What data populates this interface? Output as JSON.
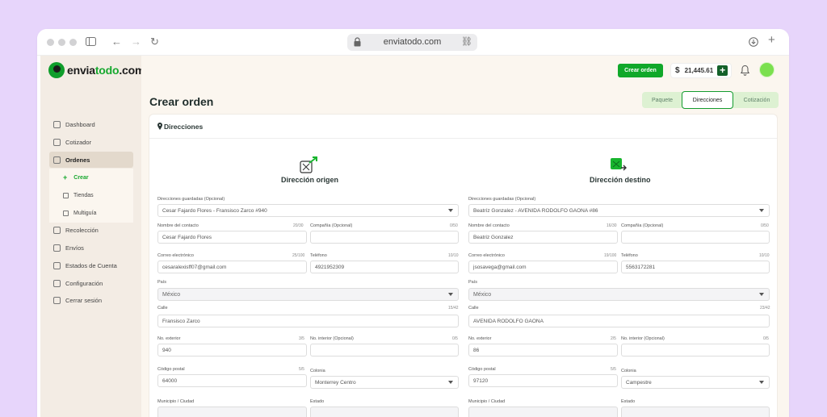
{
  "browser": {
    "url": "enviatodo.com"
  },
  "brand": {
    "name_prefix": "envia",
    "name_accent": "todo",
    "name_suffix": ".com",
    "accent_color": "#17a82f"
  },
  "sidebar": {
    "items": [
      {
        "label": "Dashboard",
        "icon": "home-icon"
      },
      {
        "label": "Cotizador",
        "icon": "calculator-icon"
      },
      {
        "label": "Ordenes",
        "icon": "orders-icon"
      },
      {
        "label": "Recolección",
        "icon": "truck-icon"
      },
      {
        "label": "Envíos",
        "icon": "send-icon"
      },
      {
        "label": "Estados de Cuenta",
        "icon": "statement-icon"
      },
      {
        "label": "Configuración",
        "icon": "gear-icon"
      },
      {
        "label": "Cerrar sesión",
        "icon": "logout-icon"
      }
    ],
    "submenu": [
      {
        "label": "Crear",
        "icon": "plus-icon"
      },
      {
        "label": "Tiendas",
        "icon": "store-icon"
      },
      {
        "label": "Multiguía",
        "icon": "multiguide-icon"
      }
    ]
  },
  "topbar": {
    "create_order_label": "Crear orden",
    "balance_symbol": "$",
    "balance": "21,445.61",
    "add_symbol": "+"
  },
  "page": {
    "title": "Crear orden",
    "steps": [
      "Paquete",
      "Direcciones",
      "Cotización"
    ],
    "active_step": "Direcciones"
  },
  "card": {
    "title": "Direcciones"
  },
  "origin": {
    "title": "Dirección origen",
    "saved_label": "Direcciones guardadas (Opcional)",
    "saved_value": "Cesar Fajardo Flores - Fransisco Zarco #940",
    "contact_label": "Nombre del contacto",
    "contact_count": "20/30",
    "contact_value": "Cesar Fajardo Flores",
    "company_label": "Compañía (Opcional)",
    "company_count": "0/50",
    "email_label": "Correo electrónico",
    "email_count": "25/100",
    "email_value": "cesaralexisff07@gmail.com",
    "phone_label": "Teléfono",
    "phone_count": "10/10",
    "phone_value": "4921952309",
    "country_label": "País",
    "country_value": "México",
    "street_label": "Calle",
    "street_count": "15/42",
    "street_value": "Fransisco Zarco",
    "ext_label": "No. exterior",
    "ext_count": "3/5",
    "ext_value": "940",
    "int_label": "No. interior (Opcional)",
    "int_count": "0/5",
    "zip_label": "Código postal",
    "zip_count": "5/5",
    "zip_value": "64000",
    "colonia_label": "Colonia",
    "colonia_value": "Monterrey Centro",
    "city_label": "Municipio / Ciudad",
    "state_label": "Estado"
  },
  "destination": {
    "title": "Dirección destino",
    "saved_label": "Direcciones guardadas (Opcional)",
    "saved_value": "Beatríz Gonzalez - AVENIDA RODOLFO GAONA #86",
    "contact_label": "Nombre del contacto",
    "contact_count": "16/30",
    "contact_value": "Beatriz Gonzalez",
    "company_label": "Compañía (Opcional)",
    "company_count": "0/50",
    "email_label": "Correo electrónico",
    "email_count": "19/100",
    "email_value": "jsosavega@gmail.com",
    "phone_label": "Teléfono",
    "phone_count": "10/10",
    "phone_value": "5563172281",
    "country_label": "País",
    "country_value": "México",
    "street_label": "Calle",
    "street_count": "23/42",
    "street_value": "AVENIDA RODOLFO GAONA",
    "ext_label": "No. exterior",
    "ext_count": "2/5",
    "ext_value": "86",
    "int_label": "No. interior (Opcional)",
    "int_count": "0/5",
    "zip_label": "Código postal",
    "zip_count": "5/5",
    "zip_value": "97120",
    "colonia_label": "Colonia",
    "colonia_value": "Campestre",
    "city_label": "Municipio / Ciudad",
    "state_label": "Estado"
  }
}
